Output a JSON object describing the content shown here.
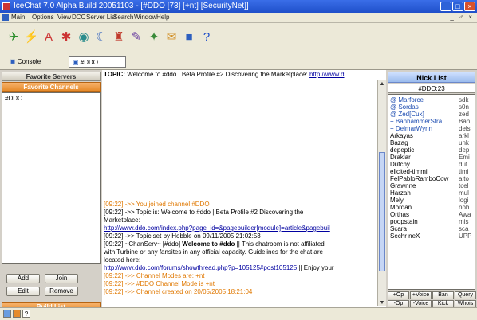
{
  "window": {
    "title": "IceChat 7.0 Alpha Build 20051103 - [#DDO [73] [+nt] [SecurityNet]]",
    "buttons": {
      "min": "_",
      "max": "□",
      "close": "×"
    },
    "mdi_buttons": "_ ♂ ×"
  },
  "menu": [
    "Main",
    "Options",
    "View",
    "DCC",
    "Server List",
    "Search",
    "Window",
    "Help"
  ],
  "toolbar": [
    {
      "icon": "quick-connect-icon",
      "glyph": "✈",
      "color": "#2a8c2a"
    },
    {
      "icon": "connect-icon",
      "glyph": "⚡",
      "color": "#2d5fbf"
    },
    {
      "icon": "font-icon",
      "glyph": "A",
      "color": "#c33"
    },
    {
      "icon": "color-palette-icon",
      "glyph": "✱",
      "color": "#c33"
    },
    {
      "icon": "channel-list-icon",
      "glyph": "◉",
      "color": "#2a8c8c"
    },
    {
      "icon": "away-icon",
      "glyph": "☾",
      "color": "#2d5fbf"
    },
    {
      "icon": "settings-icon",
      "glyph": "♜",
      "color": "#c0392b"
    },
    {
      "icon": "editor-icon",
      "glyph": "✎",
      "color": "#6a3fa0"
    },
    {
      "icon": "log-icon",
      "glyph": "✦",
      "color": "#3a8a3a"
    },
    {
      "icon": "script-icon",
      "glyph": "✉",
      "color": "#d08a1a"
    },
    {
      "icon": "plugin-icon",
      "glyph": "■",
      "color": "#2d5fbf"
    },
    {
      "icon": "help-icon",
      "glyph": "?",
      "color": "#1f4fc9"
    }
  ],
  "tabs": [
    "Console",
    "#DDO"
  ],
  "left": {
    "favorite_servers": "Favorite Servers",
    "favorite_channels": "Favorite Channels",
    "channels": [
      "#DDO"
    ],
    "buttons": {
      "add": "Add",
      "join": "Join",
      "edit": "Edit",
      "remove": "Remove"
    },
    "build_list": "Build List"
  },
  "chat": {
    "topic_label": "TOPIC:",
    "topic_text": "Welcome to #ddo | Beta Profile #2 Discovering the Marketplace:",
    "topic_url": "http://www.d",
    "lines": [
      {
        "ts": "[09:22]",
        "text": " ->> You joined channel #DDO",
        "color": "orange"
      },
      {
        "ts": "[09:22]",
        "text": " ->> Topic is: Welcome to #ddo | Beta Profile #2 Discovering the",
        "color": "normal"
      },
      {
        "ts": "",
        "text": "Marketplace:",
        "color": "normal"
      },
      {
        "ts": "",
        "text": "http://www.ddo.com/index.php?page_id=&pagebuilder[module]=article&pagebuil",
        "color": "link"
      },
      {
        "ts": "[09:22]",
        "text": " ->> Topic set by Hobble on 09/11/2005 21:02:53",
        "color": "normal"
      },
      {
        "ts": "[09:22]",
        "text": " ~ChanServ~ [#ddo] ",
        "bold": "Welcome to #ddo",
        "rest": " || This chatroom is not affiliated",
        "color": "normal"
      },
      {
        "ts": "",
        "text": "with Turbine or any fansites in any official capacity. Guidelines for the chat are",
        "color": "normal"
      },
      {
        "ts": "",
        "text": "located here:",
        "color": "normal"
      },
      {
        "ts": "",
        "text": "http://www.ddo.com/forums/showthread.php?p=105125#post105125",
        "rest": " || Enjoy your",
        "color": "link"
      },
      {
        "ts": "[09:22]",
        "text": " ->> Channel Modes are: +nt",
        "color": "orange"
      },
      {
        "ts": "[09:22]",
        "text": " ->> #DDO Channel Mode is +nt",
        "color": "orange"
      },
      {
        "ts": "[09:22]",
        "text": " ->> Channel created on 20/05/2005 18:21:04",
        "color": "orange"
      }
    ]
  },
  "nicklist": {
    "header": "Nick List",
    "channel_count": "#DDO:23",
    "nicks": [
      {
        "prefix": "@",
        "nick": "Marforce",
        "host": "sdk",
        "voice": true
      },
      {
        "prefix": "@",
        "nick": "Sordas",
        "host": "s0n",
        "voice": true
      },
      {
        "prefix": "@",
        "nick": "Zed[Cuk]",
        "host": "zed",
        "voice": true
      },
      {
        "prefix": "+",
        "nick": "BanhammerStra..",
        "host": "Ban",
        "voice": true
      },
      {
        "prefix": "+",
        "nick": "DelmarWynn",
        "host": "dels",
        "voice": true
      },
      {
        "prefix": "",
        "nick": "Arkayas",
        "host": "arkl",
        "voice": false
      },
      {
        "prefix": "",
        "nick": "Bazag",
        "host": "unk",
        "voice": false
      },
      {
        "prefix": "",
        "nick": "depeptic",
        "host": "dep",
        "voice": false
      },
      {
        "prefix": "",
        "nick": "Draklar",
        "host": "Emi",
        "voice": false
      },
      {
        "prefix": "",
        "nick": "Dutchy",
        "host": "dut",
        "voice": false
      },
      {
        "prefix": "",
        "nick": "elicited-timmi",
        "host": "timi",
        "voice": false
      },
      {
        "prefix": "",
        "nick": "FelPabloRamboCow",
        "host": "alto",
        "voice": false
      },
      {
        "prefix": "",
        "nick": "Grawnne",
        "host": "tcel",
        "voice": false
      },
      {
        "prefix": "",
        "nick": "Harzah",
        "host": "mul",
        "voice": false
      },
      {
        "prefix": "",
        "nick": "Mely",
        "host": "logi",
        "voice": false
      },
      {
        "prefix": "",
        "nick": "Mordan",
        "host": "nob",
        "voice": false
      },
      {
        "prefix": "",
        "nick": "Orthas",
        "host": "Awa",
        "voice": false
      },
      {
        "prefix": "",
        "nick": "poopstain",
        "host": "mis",
        "voice": false
      },
      {
        "prefix": "",
        "nick": "Scara",
        "host": "sca",
        "voice": false
      },
      {
        "prefix": "",
        "nick": "Sechr neX",
        "host": "UPP",
        "voice": false
      }
    ],
    "buttons_row1": [
      "+Op",
      "+Voice",
      "Ban",
      "Query"
    ],
    "buttons_row2": [
      "-Op",
      "-Voice",
      "Kick",
      "Whois"
    ]
  }
}
